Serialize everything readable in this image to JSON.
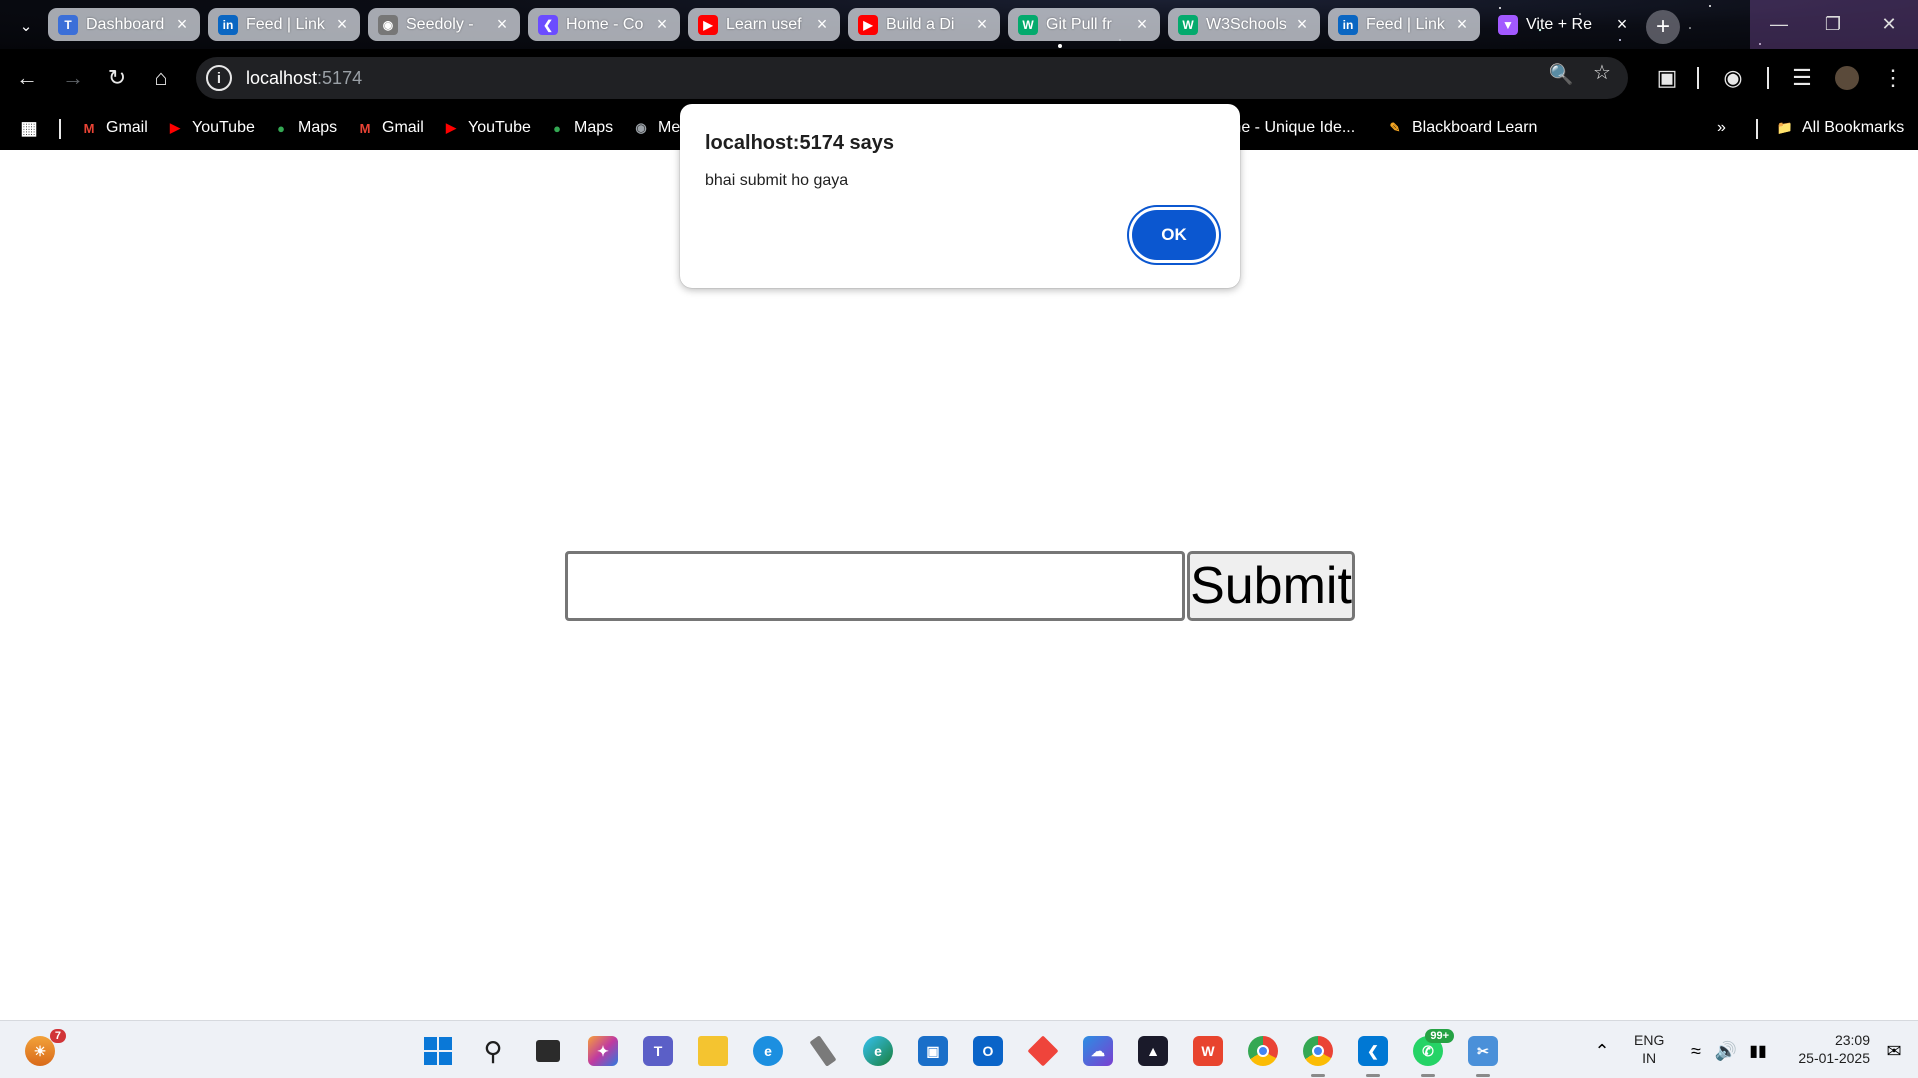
{
  "browser": {
    "tabs": [
      {
        "title": "Dashboard",
        "icon_color": "#3b6fd8",
        "icon": "tata-icon"
      },
      {
        "title": "Feed | Link",
        "icon_color": "#0a66c2",
        "icon": "linkedin-icon"
      },
      {
        "title": "Seedoly - ",
        "icon_color": "#777777",
        "icon": "globe-icon"
      },
      {
        "title": "Home - Co",
        "icon_color": "#6b4cff",
        "icon": "code-icon"
      },
      {
        "title": "Learn usef",
        "icon_color": "#ff0000",
        "icon": "youtube-icon"
      },
      {
        "title": "Build a Di",
        "icon_color": "#ff0000",
        "icon": "youtube-icon"
      },
      {
        "title": "Git Pull fr",
        "icon_color": "#04aa6d",
        "icon": "w3schools-icon"
      },
      {
        "title": "W3Schools",
        "icon_color": "#04aa6d",
        "icon": "w3schools-icon"
      },
      {
        "title": "Feed | Link",
        "icon_color": "#0a66c2",
        "icon": "linkedin-icon"
      },
      {
        "title": "Vite + Re",
        "icon_color": "#a259ff",
        "icon": "vite-icon"
      }
    ],
    "url_host": "localhost",
    "url_port": ":5174",
    "bookmarks": [
      {
        "label": "Gmail",
        "icon": "gmail-icon"
      },
      {
        "label": "YouTube",
        "icon": "youtube-icon"
      },
      {
        "label": "Maps",
        "icon": "maps-icon"
      },
      {
        "label": "Gmail",
        "icon": "gmail-icon"
      },
      {
        "label": "YouTube",
        "icon": "youtube-icon"
      },
      {
        "label": "Maps",
        "icon": "maps-icon"
      },
      {
        "label": "Me",
        "icon": "globe-icon"
      },
      {
        "label": "me - Unique Ide...",
        "icon": ""
      },
      {
        "label": "Blackboard Learn",
        "icon": "blackboard-icon"
      }
    ],
    "all_bookmarks": "All Bookmarks"
  },
  "dialog": {
    "title": "localhost:5174 says",
    "message": "bhai submit ho gaya",
    "ok_label": "OK"
  },
  "page": {
    "input_value": "",
    "submit_label": "Submit"
  },
  "taskbar": {
    "weather_badge": "7",
    "whatsapp_badge": "99+",
    "lang_line1": "ENG",
    "lang_line2": "IN",
    "time": "23:09",
    "date": "25-01-2025"
  }
}
